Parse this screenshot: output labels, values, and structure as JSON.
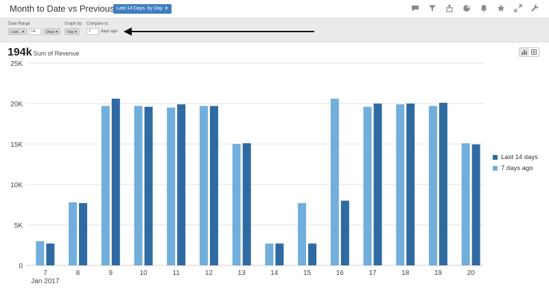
{
  "header": {
    "title": "Month to Date vs Previous Periods",
    "range_pill": "Last 14 Days, by Day",
    "icons": [
      "comment-icon",
      "filter-icon",
      "share-icon",
      "pie-chart-icon",
      "bell-icon",
      "star-icon",
      "expand-icon",
      "wrench-icon"
    ]
  },
  "filters": {
    "date_range_label": "Date Range",
    "date_range_mode": "Last...",
    "date_range_count": "14",
    "date_range_unit": "Days",
    "graph_by_label": "Graph by",
    "graph_by_value": "Day",
    "compare_to_label": "Compare to",
    "compare_to_value": "7",
    "compare_to_suffix": "days ago"
  },
  "summary": {
    "total": "194k",
    "metric": "Sum of Revenue"
  },
  "colors": {
    "current": "#2f6aa3",
    "previous": "#71aedc",
    "pill": "#3f7fc1",
    "grid": "#e3e3e3"
  },
  "chart_data": {
    "type": "bar",
    "categories": [
      "7",
      "8",
      "9",
      "10",
      "11",
      "12",
      "13",
      "14",
      "15",
      "16",
      "17",
      "18",
      "19",
      "20"
    ],
    "x_sublabel": "Jan 2017",
    "series": [
      {
        "name": "7 days ago",
        "values": [
          3000,
          7800,
          19700,
          19700,
          19500,
          19700,
          15000,
          2700,
          7700,
          20600,
          19600,
          19900,
          19700,
          15100
        ]
      },
      {
        "name": "Last 14 days",
        "values": [
          2700,
          7700,
          20600,
          19600,
          19900,
          19700,
          15100,
          2700,
          2700,
          8000,
          20000,
          20000,
          20100,
          14950
        ]
      }
    ],
    "ylim": [
      0,
      25000
    ],
    "yticks": [
      0,
      5000,
      10000,
      15000,
      20000,
      25000
    ],
    "ytick_labels": [
      "0",
      "5K",
      "10K",
      "15K",
      "20K",
      "25K"
    ],
    "legend_order": [
      "Last 14 days",
      "7 days ago"
    ],
    "legend_position": "right",
    "grid": true
  }
}
